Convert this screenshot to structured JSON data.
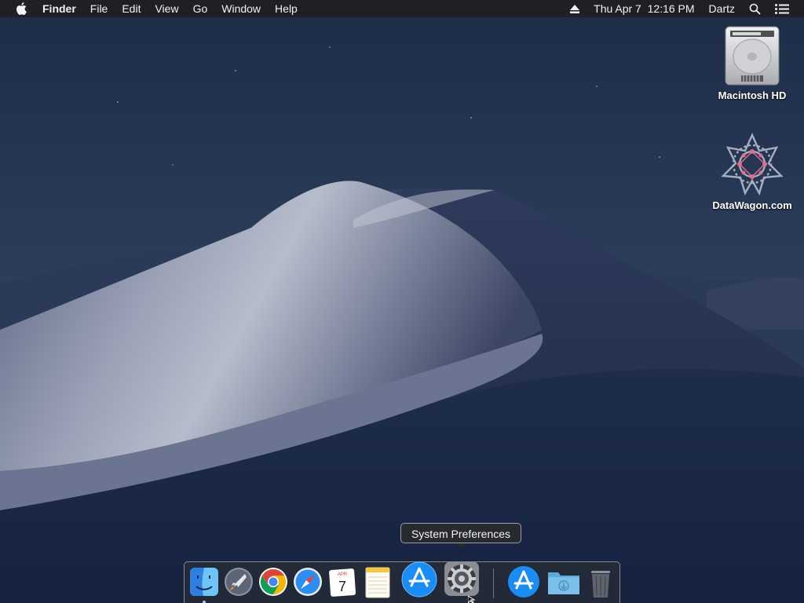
{
  "menubar": {
    "apple_icon": "apple-logo-icon",
    "app_name": "Finder",
    "menus": [
      "File",
      "Edit",
      "View",
      "Go",
      "Window",
      "Help"
    ],
    "status": {
      "eject_icon": "eject-icon",
      "datetime": "Thu Apr 7  12:16 PM",
      "user": "Dartz",
      "search_icon": "spotlight-search-icon",
      "list_icon": "notification-center-icon"
    }
  },
  "desktop_icons": [
    {
      "label": "Macintosh HD",
      "icon": "hard-drive-icon"
    },
    {
      "label": "DataWagon.com",
      "icon": "network-volume-icon"
    }
  ],
  "tooltip": {
    "text": "System Preferences"
  },
  "dock": {
    "items": [
      {
        "name": "Finder",
        "icon": "finder-icon",
        "running": true
      },
      {
        "name": "Launchpad",
        "icon": "launchpad-icon",
        "running": false
      },
      {
        "name": "Google Chrome",
        "icon": "chrome-icon",
        "running": false
      },
      {
        "name": "Safari",
        "icon": "safari-icon",
        "running": false
      },
      {
        "name": "Calendar",
        "icon": "calendar-icon",
        "running": false,
        "month": "APR",
        "day": "7"
      },
      {
        "name": "Notes",
        "icon": "notes-icon",
        "running": false
      },
      {
        "name": "App Store",
        "icon": "app-store-icon",
        "running": false
      },
      {
        "name": "System Preferences",
        "icon": "system-preferences-icon",
        "running": false
      },
      {
        "name": "App Store Downloads",
        "icon": "app-store-downloads-icon",
        "running": false
      },
      {
        "name": "Downloads",
        "icon": "downloads-folder-icon",
        "running": false
      },
      {
        "name": "Trash",
        "icon": "trash-icon",
        "running": false
      }
    ]
  },
  "colors": {
    "sky": "#1b2a44",
    "dune": "#8d95ad",
    "menubar": "#1e2024",
    "app_store_blue": "#1a8cf5"
  }
}
